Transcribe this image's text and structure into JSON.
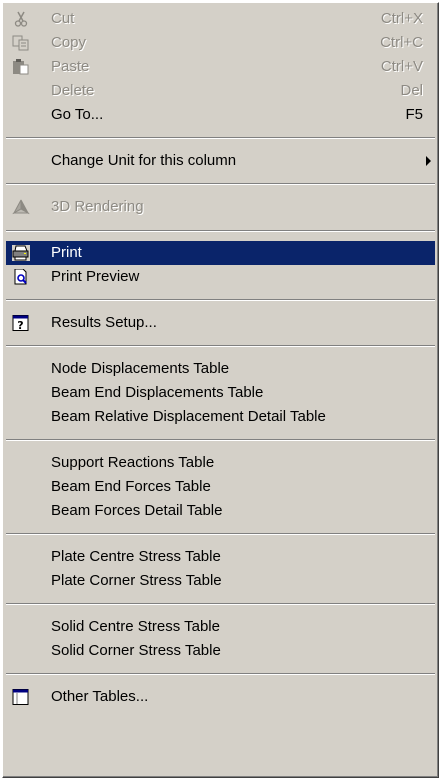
{
  "menu": {
    "cut": {
      "label": "Cut",
      "shortcut": "Ctrl+X",
      "icon": "scissors-icon"
    },
    "copy": {
      "label": "Copy",
      "shortcut": "Ctrl+C",
      "icon": "copy-icon"
    },
    "paste": {
      "label": "Paste",
      "shortcut": "Ctrl+V",
      "icon": "paste-icon"
    },
    "delete": {
      "label": "Delete",
      "shortcut": "Del"
    },
    "goto": {
      "label": "Go To...",
      "shortcut": "F5"
    },
    "change_unit": {
      "label": "Change Unit for this column"
    },
    "rendering": {
      "label": "3D Rendering",
      "icon": "3d-rendering-icon"
    },
    "print": {
      "label": "Print",
      "icon": "printer-icon"
    },
    "print_preview": {
      "label": "Print Preview",
      "icon": "print-preview-icon"
    },
    "results_setup": {
      "label": "Results Setup...",
      "icon": "results-setup-icon"
    },
    "node_disp": {
      "label": "Node Displacements Table"
    },
    "beam_end_disp": {
      "label": "Beam End Displacements Table"
    },
    "beam_rel_disp": {
      "label": "Beam Relative Displacement Detail Table"
    },
    "support_reactions": {
      "label": "Support Reactions Table"
    },
    "beam_end_forces": {
      "label": "Beam End Forces Table"
    },
    "beam_forces_detail": {
      "label": "Beam Forces Detail Table"
    },
    "plate_centre": {
      "label": "Plate Centre Stress Table"
    },
    "plate_corner": {
      "label": "Plate Corner Stress Table"
    },
    "solid_centre": {
      "label": "Solid Centre Stress Table"
    },
    "solid_corner": {
      "label": "Solid Corner Stress Table"
    },
    "other_tables": {
      "label": "Other Tables...",
      "icon": "table-icon"
    }
  },
  "colors": {
    "menu_bg": "#d4d0c8",
    "highlight": "#0a246a",
    "disabled_text": "#8d8a83"
  }
}
